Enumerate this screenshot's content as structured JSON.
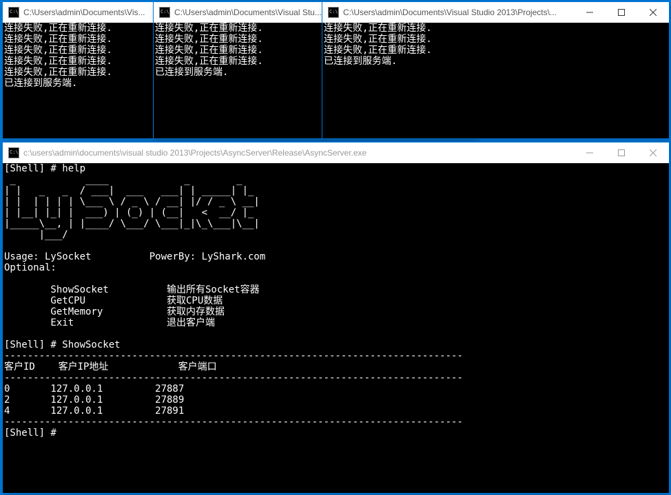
{
  "clients": [
    {
      "title": "C:\\Users\\admin\\Documents\\Vis...",
      "lines": [
        "连接失败,正在重新连接.",
        "连接失败,正在重新连接.",
        "连接失败,正在重新连接.",
        "连接失败,正在重新连接.",
        "连接失败,正在重新连接.",
        "已连接到服务端."
      ]
    },
    {
      "title": "C:\\Users\\admin\\Documents\\Visual Stu...",
      "lines": [
        "连接失败,正在重新连接.",
        "连接失败,正在重新连接.",
        "连接失败,正在重新连接.",
        "连接失败,正在重新连接.",
        "已连接到服务端."
      ]
    },
    {
      "title": "C:\\Users\\admin\\Documents\\Visual Studio 2013\\Projects\\...",
      "lines": [
        "连接失败,正在重新连接.",
        "连接失败,正在重新连接.",
        "连接失败,正在重新连接.",
        "已连接到服务端."
      ]
    }
  ],
  "server": {
    "title": "c:\\users\\admin\\documents\\visual studio 2013\\Projects\\AsyncServer\\Release\\AsyncServer.exe",
    "prompt_help": "[Shell] # help",
    "ascii_logo_lines": [
      " _            ____             _        _",
      "| |   _   _  / ___|  ___   ___| | _____| |_",
      "| |  | | | | \\___ \\ / _ \\ / __| |/ / _ \\ __|",
      "| |__| |_| |  ___) | (_) | (__|   <  __/ |_",
      "|_____\\__, | |____/ \\___/ \\___|_|\\_\\___|\\__|",
      "      |___/"
    ],
    "usage_line": "Usage: LySocket          PowerBy: LyShark.com",
    "optional_label": "Optional:",
    "options": [
      {
        "cmd": "ShowSocket",
        "desc": "输出所有Socket容器"
      },
      {
        "cmd": "GetCPU",
        "desc": "获取CPU数据"
      },
      {
        "cmd": "GetMemory",
        "desc": "获取内存数据"
      },
      {
        "cmd": "Exit",
        "desc": "退出客户端"
      }
    ],
    "prompt_show": "[Shell] # ShowSocket",
    "dash_line": "-------------------------------------------------------------------------------",
    "table_header": {
      "id": "客户ID",
      "ip": "客户IP地址",
      "port": "客户端口"
    },
    "table_rows": [
      {
        "id": "0",
        "ip": "127.0.0.1",
        "port": "27887"
      },
      {
        "id": "2",
        "ip": "127.0.0.1",
        "port": "27889"
      },
      {
        "id": "4",
        "ip": "127.0.0.1",
        "port": "27891"
      }
    ],
    "prompt_final": "[Shell] # "
  },
  "winbtn": {
    "min": "min",
    "max": "max",
    "close": "close"
  }
}
